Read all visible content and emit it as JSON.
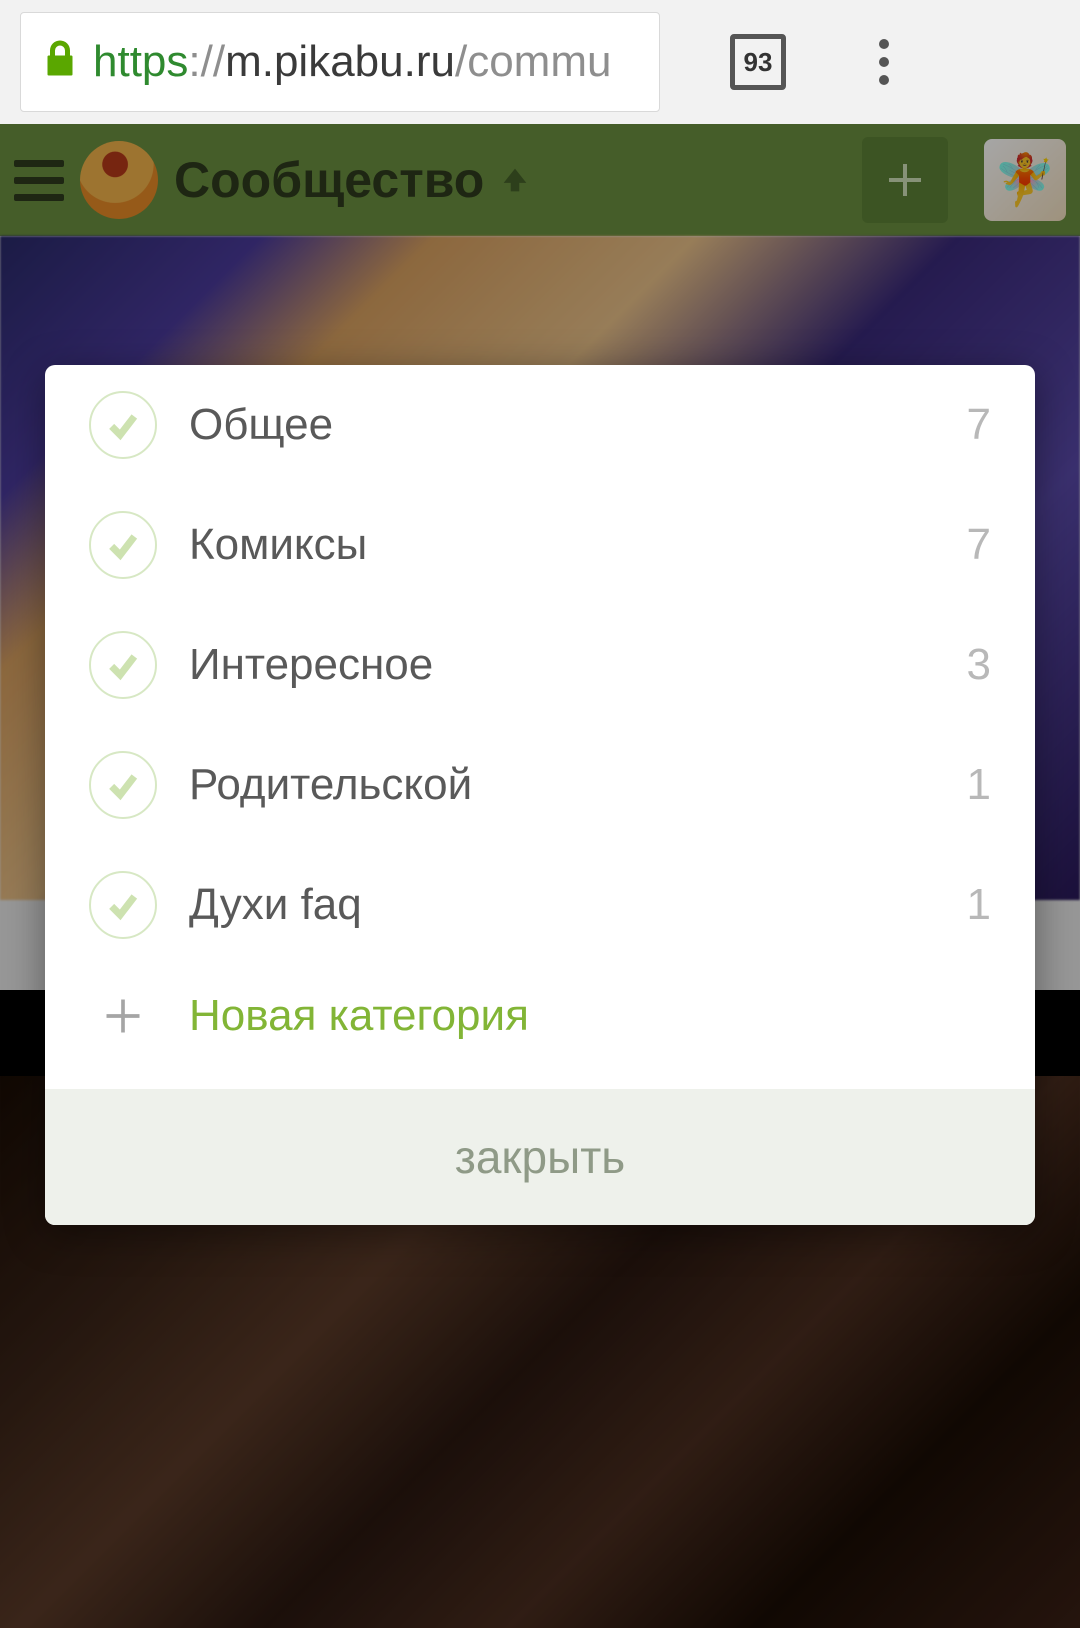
{
  "browser": {
    "url_scheme": "https",
    "url_sep": "://",
    "url_host": "m.pikabu.ru",
    "url_path": "/commu",
    "tab_count": "93"
  },
  "header": {
    "title": "Сообщество"
  },
  "modal": {
    "categories": [
      {
        "label": "Общее",
        "count": "7"
      },
      {
        "label": "Комиксы",
        "count": "7"
      },
      {
        "label": "Интересное",
        "count": "3"
      },
      {
        "label": "Родительской",
        "count": "1"
      },
      {
        "label": "Духи faq",
        "count": "1"
      }
    ],
    "new_label": "Новая категория",
    "close_label": "закрыть"
  }
}
